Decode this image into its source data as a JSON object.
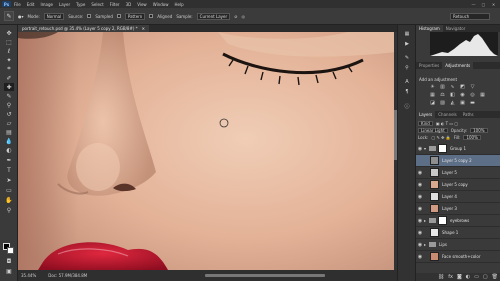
{
  "app": {
    "logo": "Ps"
  },
  "menu": [
    "File",
    "Edit",
    "Image",
    "Layer",
    "Type",
    "Select",
    "Filter",
    "3D",
    "View",
    "Window",
    "Help"
  ],
  "window_controls": [
    "—",
    "▢",
    "✕"
  ],
  "options": {
    "mode_label": "Mode:",
    "mode_value": "Normal",
    "source_label": "Source:",
    "source_value": "Sampled",
    "pattern_value": "Pattern",
    "aligned_label": "Aligned",
    "sample_label": "Sample:",
    "sample_value": "Current Layer",
    "workspace_value": "Retouch"
  },
  "document": {
    "tab_title": "portrait_retouch.psd @ 35.4% (Layer 5 copy 2, RGB/8#) *",
    "close": "✕"
  },
  "status": {
    "zoom": "35.44%",
    "doc_info": "Doc: 57.9M/384.8M"
  },
  "panels": {
    "tabs_top": [
      "Histogram",
      "Navigator"
    ],
    "tabs_adjust": [
      "Properties",
      "Adjustments"
    ],
    "adjust_title": "Add an adjustment",
    "tabs_layers": [
      "Layers",
      "Channels",
      "Paths"
    ],
    "kind_label": "Kind",
    "blend_mode": "Linear Light",
    "opacity_label": "Opacity:",
    "opacity_value": "100%",
    "lock_label": "Lock:",
    "fill_label": "Fill:",
    "fill_value": "100%"
  },
  "layers": [
    {
      "name": "Group 1",
      "kind": "group",
      "visible": true,
      "selected": false,
      "thumb": "#ffffff"
    },
    {
      "name": "Layer 5 copy 2",
      "kind": "layer",
      "visible": false,
      "selected": true,
      "thumb": "#8e8e8e"
    },
    {
      "name": "Layer 5",
      "kind": "layer",
      "visible": true,
      "selected": false,
      "thumb": "#c9c9c9"
    },
    {
      "name": "Layer 5 copy",
      "kind": "layer",
      "visible": true,
      "selected": false,
      "thumb": "#d9a98f"
    },
    {
      "name": "Layer 4",
      "kind": "layer",
      "visible": true,
      "selected": false,
      "thumb": "#dfdfdf"
    },
    {
      "name": "Layer 3",
      "kind": "layer",
      "visible": true,
      "selected": false,
      "thumb": "#d19a82"
    },
    {
      "name": "eyebrows",
      "kind": "group",
      "visible": true,
      "selected": false,
      "thumb": "#ffffff"
    },
    {
      "name": "Shape 1",
      "kind": "layer",
      "visible": true,
      "selected": false,
      "thumb": "#e8e8e8"
    },
    {
      "name": "Lips",
      "kind": "group",
      "visible": true,
      "selected": false,
      "thumb": "#ffffff"
    },
    {
      "name": "Face smooth+color",
      "kind": "layer",
      "visible": true,
      "selected": false,
      "thumb": "#c98a72"
    }
  ],
  "colors": {
    "skin_light": "#e9c1a8",
    "skin_mid": "#d9a489",
    "skin_shadow": "#b5806a",
    "lips": "#c41530",
    "selection": "#5d6e87"
  }
}
